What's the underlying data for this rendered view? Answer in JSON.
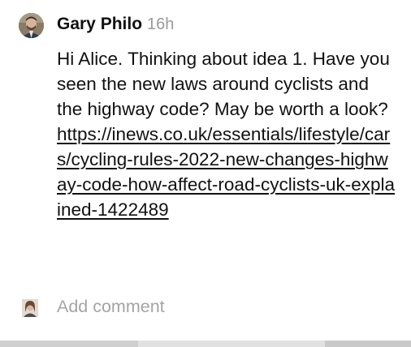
{
  "comment": {
    "author": "Gary Philo",
    "time": "16h",
    "text": "Hi Alice. Thinking about idea 1. Have you seen the new laws around cyclists and the highway code? May be worth a look?",
    "link": "https://inews.co.uk/essentials/lifestyle/cars/cycling-rules-2022-new-changes-highway-code-how-affect-road-cyclists-uk-explained-1422489"
  },
  "reply": {
    "placeholder": "Add comment"
  },
  "icons": {
    "author_avatar": "user-avatar-photo",
    "current_user_avatar": "user-avatar-photo"
  }
}
